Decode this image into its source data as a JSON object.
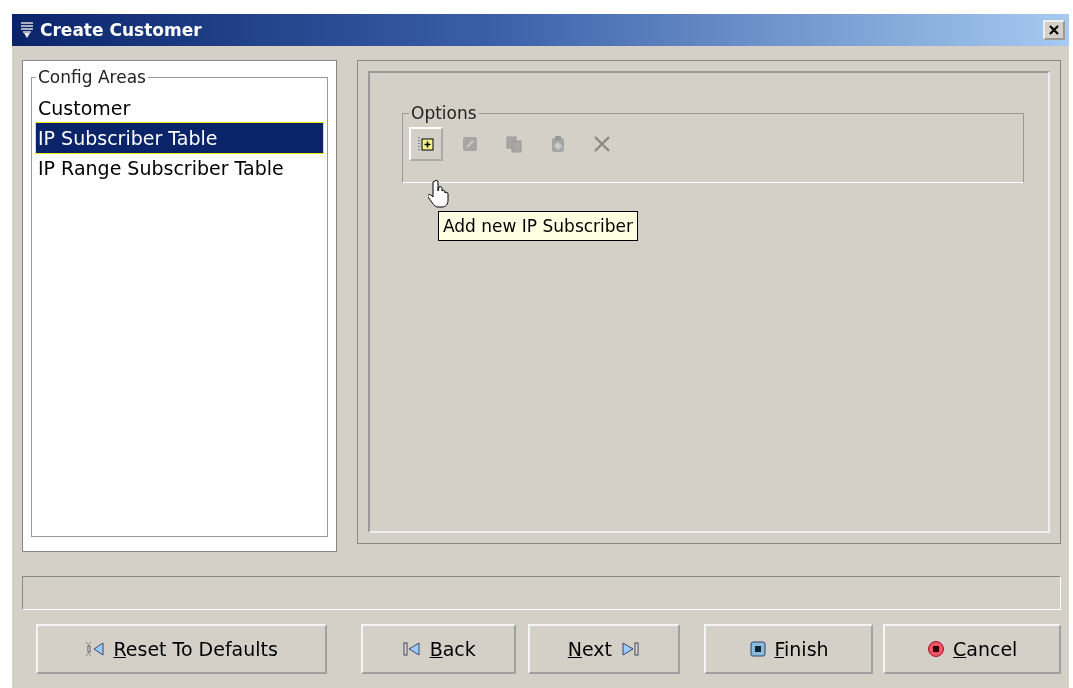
{
  "window": {
    "title": "Create Customer"
  },
  "config_areas": {
    "title": "Config Areas",
    "items": [
      {
        "label": "Customer",
        "selected": false
      },
      {
        "label": "IP Subscriber Table",
        "selected": true
      },
      {
        "label": "IP Range Subscriber Table",
        "selected": false
      }
    ]
  },
  "options": {
    "title": "Options",
    "tools": [
      {
        "kind": "add",
        "disabled": false
      },
      {
        "kind": "edit",
        "disabled": true
      },
      {
        "kind": "copy",
        "disabled": true
      },
      {
        "kind": "paste",
        "disabled": true
      },
      {
        "kind": "delete",
        "disabled": true
      }
    ],
    "tooltip": "Add new IP Subscriber"
  },
  "buttons": [
    {
      "kind": "reset",
      "label": "Reset To Defaults",
      "underline_first": true
    },
    {
      "kind": "back",
      "label": "Back",
      "underline_first": true
    },
    {
      "kind": "next",
      "label": "Next",
      "underline_first": true
    },
    {
      "kind": "finish",
      "label": "Finish",
      "underline_first": true
    },
    {
      "kind": "cancel",
      "label": "Cancel",
      "underline_first": true
    }
  ]
}
